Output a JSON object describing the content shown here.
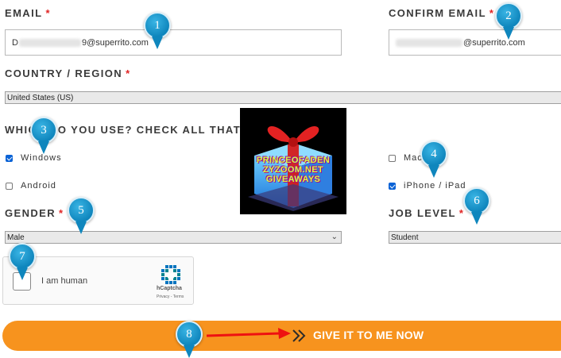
{
  "form": {
    "email": {
      "label": "EMAIL",
      "value_suffix": "9@superrito.com"
    },
    "confirm_email": {
      "label": "CONFIRM EMAIL",
      "value_suffix": "@superrito.com"
    },
    "country": {
      "label": "COUNTRY / REGION",
      "value": "United States (US)"
    },
    "devices": {
      "label": "WHICH DO YOU USE? CHECK ALL THAT APPLY",
      "options": [
        {
          "label": "Windows",
          "checked": true
        },
        {
          "label": "Android",
          "checked": false
        },
        {
          "label": "Mac",
          "checked": false
        },
        {
          "label": "iPhone / iPad",
          "checked": true
        }
      ]
    },
    "gender": {
      "label": "GENDER",
      "value": "Male"
    },
    "job_level": {
      "label": "JOB LEVEL",
      "value": "Student"
    },
    "required_mark": "*",
    "captcha": {
      "label": "I am human",
      "brand": "hCaptcha",
      "links": "Privacy - Terms"
    },
    "submit": {
      "label": "GIVE IT TO ME NOW",
      "color": "#f7931e"
    }
  },
  "overlay": {
    "text_lines": [
      "PRINCEOFADEN",
      "ZYZOOM.NET",
      "GIVEAWAYS"
    ]
  },
  "markers": [
    "1",
    "2",
    "3",
    "4",
    "5",
    "6",
    "7",
    "8"
  ],
  "colors": {
    "accent": "#f7931e",
    "marker": "#1e9bd7",
    "required": "#e02424",
    "checkbox": "#0b63d6"
  }
}
